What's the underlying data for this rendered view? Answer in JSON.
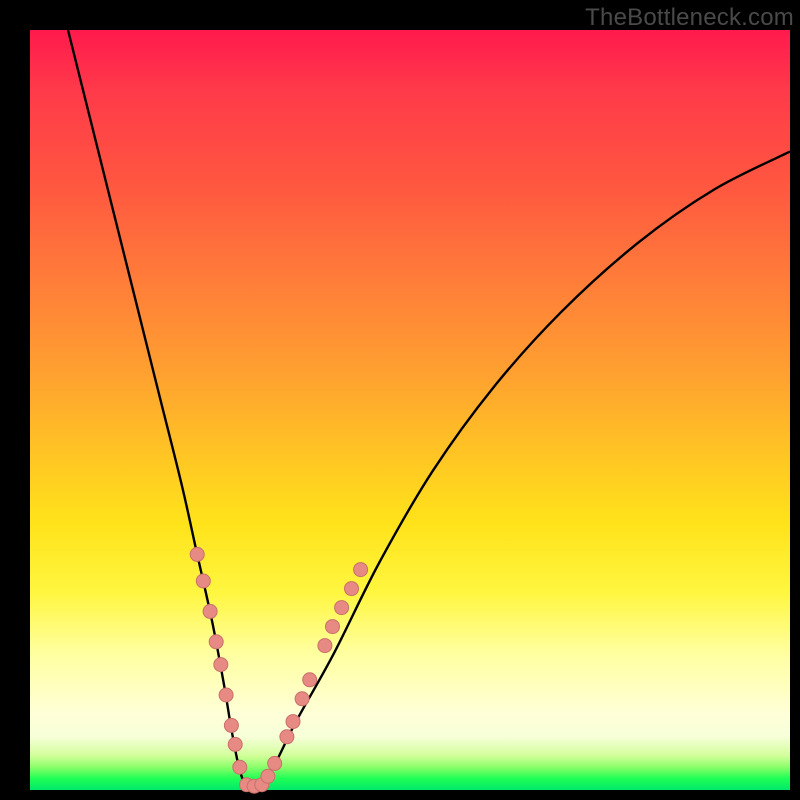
{
  "watermark": "TheBottleneck.com",
  "colors": {
    "frame": "#000000",
    "curve": "#000000",
    "bead_fill": "#e88a84",
    "bead_stroke": "#c96f6a"
  },
  "chart_data": {
    "type": "line",
    "title": "",
    "xlabel": "",
    "ylabel": "",
    "xlim": [
      0,
      100
    ],
    "ylim": [
      0,
      100
    ],
    "series": [
      {
        "name": "bottleneck-mismatch-curve",
        "x": [
          5,
          8,
          11,
          14,
          17,
          20,
          22,
          24,
          25.5,
          26.5,
          27.5,
          28.5,
          30,
          32,
          35,
          40,
          46,
          53,
          61,
          70,
          80,
          90,
          100
        ],
        "y": [
          100,
          88,
          76,
          64,
          52,
          40,
          31,
          22,
          14,
          8,
          3,
          0.5,
          0.5,
          3,
          9,
          18,
          30,
          42,
          53,
          63,
          72,
          79,
          84
        ]
      }
    ],
    "markers": [
      {
        "x": 22.0,
        "y": 31.0
      },
      {
        "x": 22.8,
        "y": 27.5
      },
      {
        "x": 23.7,
        "y": 23.5
      },
      {
        "x": 24.5,
        "y": 19.5
      },
      {
        "x": 25.1,
        "y": 16.5
      },
      {
        "x": 25.8,
        "y": 12.5
      },
      {
        "x": 26.5,
        "y": 8.5
      },
      {
        "x": 27.0,
        "y": 6.0
      },
      {
        "x": 27.6,
        "y": 3.0
      },
      {
        "x": 28.5,
        "y": 0.7
      },
      {
        "x": 29.5,
        "y": 0.5
      },
      {
        "x": 30.5,
        "y": 0.7
      },
      {
        "x": 31.3,
        "y": 1.8
      },
      {
        "x": 32.2,
        "y": 3.5
      },
      {
        "x": 33.8,
        "y": 7.0
      },
      {
        "x": 34.6,
        "y": 9.0
      },
      {
        "x": 35.8,
        "y": 12.0
      },
      {
        "x": 36.8,
        "y": 14.5
      },
      {
        "x": 38.8,
        "y": 19.0
      },
      {
        "x": 39.8,
        "y": 21.5
      },
      {
        "x": 41.0,
        "y": 24.0
      },
      {
        "x": 42.3,
        "y": 26.5
      },
      {
        "x": 43.5,
        "y": 29.0
      }
    ]
  }
}
